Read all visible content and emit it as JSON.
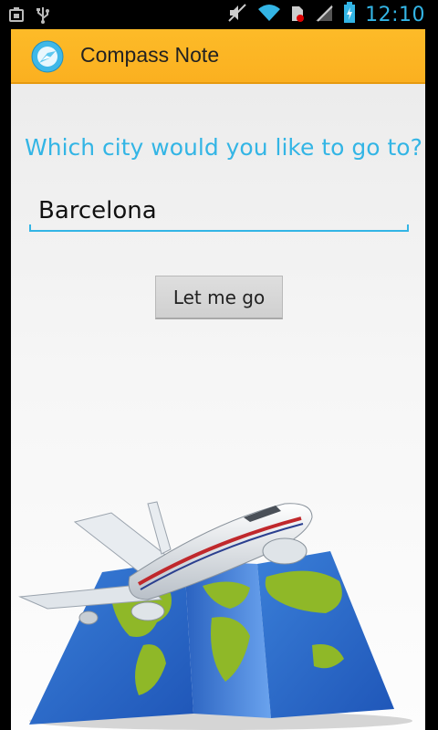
{
  "status_bar": {
    "time": "12:10",
    "icons": [
      "android-debug-icon",
      "usb-icon",
      "mute-icon",
      "wifi-icon",
      "sim-icon",
      "signal-icon",
      "battery-charging-icon"
    ]
  },
  "action_bar": {
    "title": "Compass Note",
    "app_icon": "compass-note-icon"
  },
  "main": {
    "question": "Which city would you like to go to?",
    "city_input_value": "Barcelona",
    "go_button_label": "Let me go",
    "illustration": "airplane-over-world-map"
  },
  "colors": {
    "accent": "#33b5e5",
    "action_bar": "#fbb020"
  }
}
